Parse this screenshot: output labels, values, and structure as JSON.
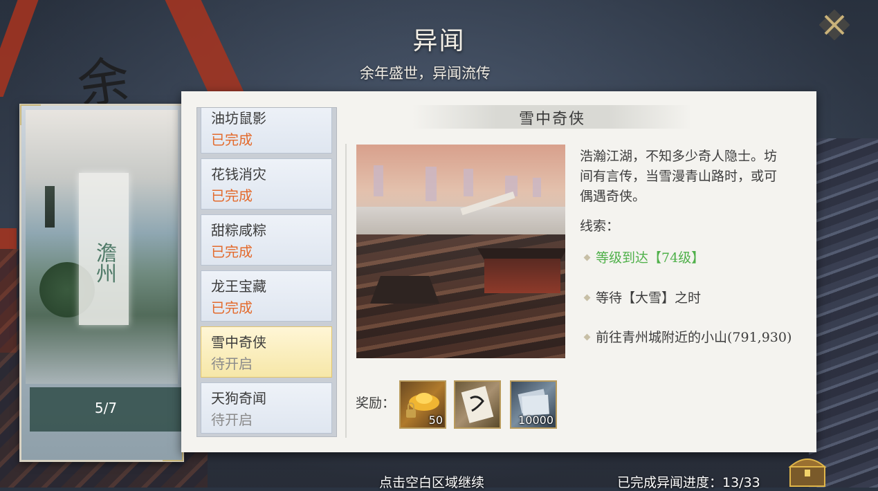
{
  "header": {
    "title": "异闻",
    "subtitle": "余年盛世，异闻流传",
    "background_calligraphy": "余"
  },
  "region": {
    "name": "澹州",
    "progress": "5/7"
  },
  "quests": [
    {
      "name": "油坊鼠影",
      "status": "已完成",
      "state": "done"
    },
    {
      "name": "花钱消灾",
      "status": "已完成",
      "state": "done"
    },
    {
      "name": "甜粽咸粽",
      "status": "已完成",
      "state": "done"
    },
    {
      "name": "龙王宝藏",
      "status": "已完成",
      "state": "done"
    },
    {
      "name": "雪中奇侠",
      "status": "待开启",
      "state": "pending",
      "selected": true
    },
    {
      "name": "天狗奇闻",
      "status": "待开启",
      "state": "pending"
    }
  ],
  "detail": {
    "title": "雪中奇侠",
    "description": "浩瀚江湖，不知多少奇人隐士。坊间有言传，当雪漫青山路时，或可偶遇奇侠。",
    "clue_label": "线索：",
    "clues": [
      {
        "text": "等级到达【74级】",
        "met": true
      },
      {
        "text": "等待【大雪】之时",
        "met": false
      },
      {
        "text": "前往青州城附近的小山(791,930)",
        "met": false
      }
    ],
    "reward_label": "奖励：",
    "rewards": [
      {
        "icon": "gold-ingot-locked-icon",
        "count": "50"
      },
      {
        "icon": "scroll-icon",
        "count": ""
      },
      {
        "icon": "silver-notes-icon",
        "count": "10000"
      }
    ]
  },
  "footer": {
    "hint": "点击空白区域继续",
    "progress": "已完成异闻进度：13/33"
  },
  "colors": {
    "done_status": "#e36a2c",
    "pending_status": "#8a8a8a",
    "clue_met": "#4fb04a",
    "selected_item": "#f6e7a8"
  }
}
